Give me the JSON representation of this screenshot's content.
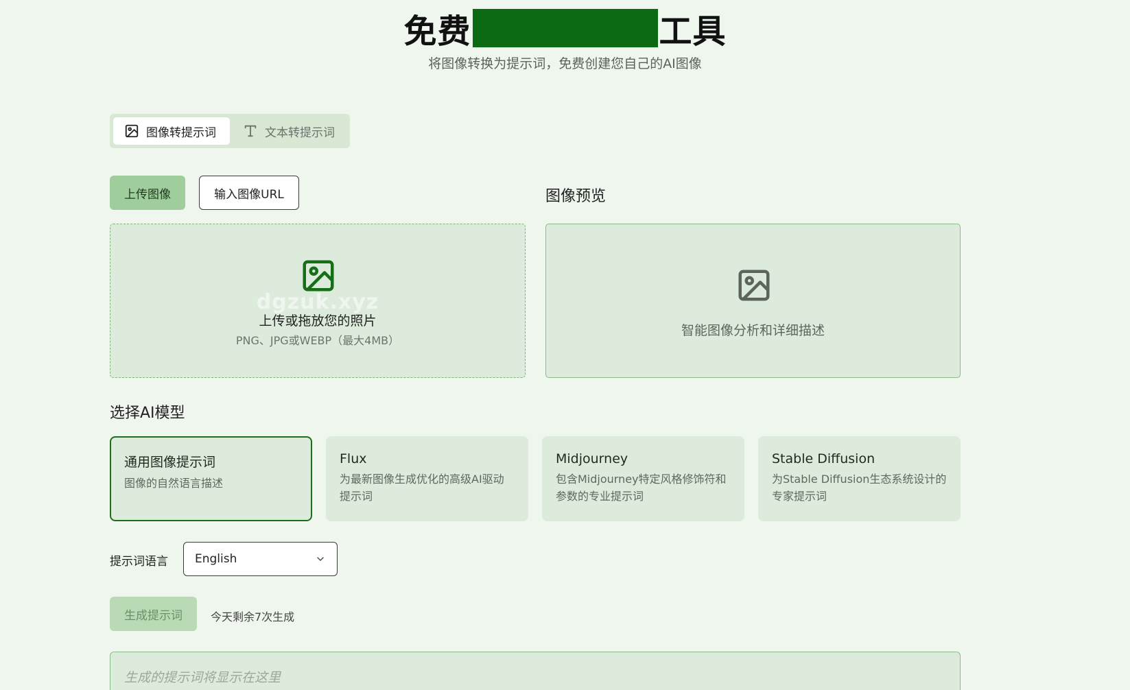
{
  "hero": {
    "title_prefix": "免费",
    "title_suffix": "工具",
    "redaction_color": "#0c6a12",
    "subtitle": "将图像转换为提示词，免费创建您自己的AI图像"
  },
  "mode_tabs": [
    {
      "label": "图像转提示词",
      "icon": "image-icon",
      "active": true
    },
    {
      "label": "文本转提示词",
      "icon": "text-icon",
      "active": false
    }
  ],
  "upload": {
    "upload_button_label": "上传图像",
    "url_button_label": "输入图像URL",
    "dropzone_title": "上传或拖放您的照片",
    "dropzone_hint": "PNG、JPG或WEBP（最大4MB）",
    "watermark": "dgzuk.xyz",
    "icon": "image-upload-icon"
  },
  "preview": {
    "heading": "图像预览",
    "text": "智能图像分析和详细描述",
    "icon": "image-placeholder-icon"
  },
  "models": {
    "heading": "选择AI模型",
    "cards": [
      {
        "title": "通用图像提示词",
        "desc": "图像的自然语言描述",
        "selected": true
      },
      {
        "title": "Flux",
        "desc": "为最新图像生成优化的高级AI驱动提示词",
        "selected": false
      },
      {
        "title": "Midjourney",
        "desc": "包含Midjourney特定风格修饰符和参数的专业提示词",
        "selected": false
      },
      {
        "title": "Stable Diffusion",
        "desc": "为Stable Diffusion生态系统设计的专家提示词",
        "selected": false
      }
    ]
  },
  "language": {
    "label": "提示词语言",
    "selected": "English"
  },
  "generate": {
    "button_label": "生成提示词",
    "remaining_text": "今天剩余7次生成"
  },
  "output": {
    "placeholder": "生成的提示词将显示在这里"
  },
  "colors": {
    "background": "#eff6ee",
    "panel": "#dcebdb",
    "accent": "#1d6e1d",
    "primary_button": "#9fcd9b"
  }
}
